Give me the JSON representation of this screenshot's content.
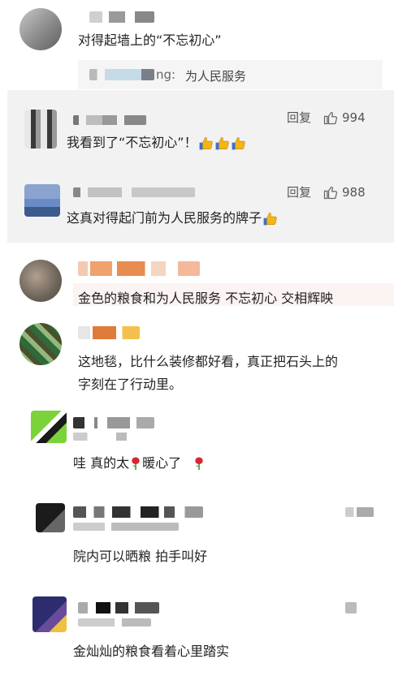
{
  "comments": [
    {
      "text": "对得起墙上的“不忘初心”",
      "reply": {
        "author_suffix": "ng:",
        "text": "为人民服务"
      }
    },
    {
      "text": "我看到了“不忘初心”！",
      "reply_label": "回复",
      "likes": "994",
      "thumbs_count": 3
    },
    {
      "text": "这真对得起门前为人民服务的牌子",
      "reply_label": "回复",
      "likes": "988",
      "thumbs_count": 1
    },
    {
      "text": "金色的粮食和为人民服务 不忘初心 交相辉映"
    },
    {
      "text_line1": "这地毯，比什么装修都好看，真正把石头上的",
      "text_line2": "字刻在了行动里。"
    },
    {
      "text_a": "哇  真的太",
      "text_b": "暖心了"
    },
    {
      "text": "院内可以晒粮   拍手叫好"
    },
    {
      "text": "金灿灿的粮食看着心里踏实"
    }
  ],
  "colors": {
    "highlight_bg": "#f2f2f2",
    "reply_bg": "#f5f5f5",
    "text": "#222222",
    "muted": "#555555",
    "thumb": "#f3b51a",
    "rose": "#d8272d"
  },
  "icons": {
    "like": "thumb-up-outline-icon",
    "emoji_thumb": "thumbs-up-emoji-icon",
    "emoji_rose": "rose-emoji-icon"
  }
}
